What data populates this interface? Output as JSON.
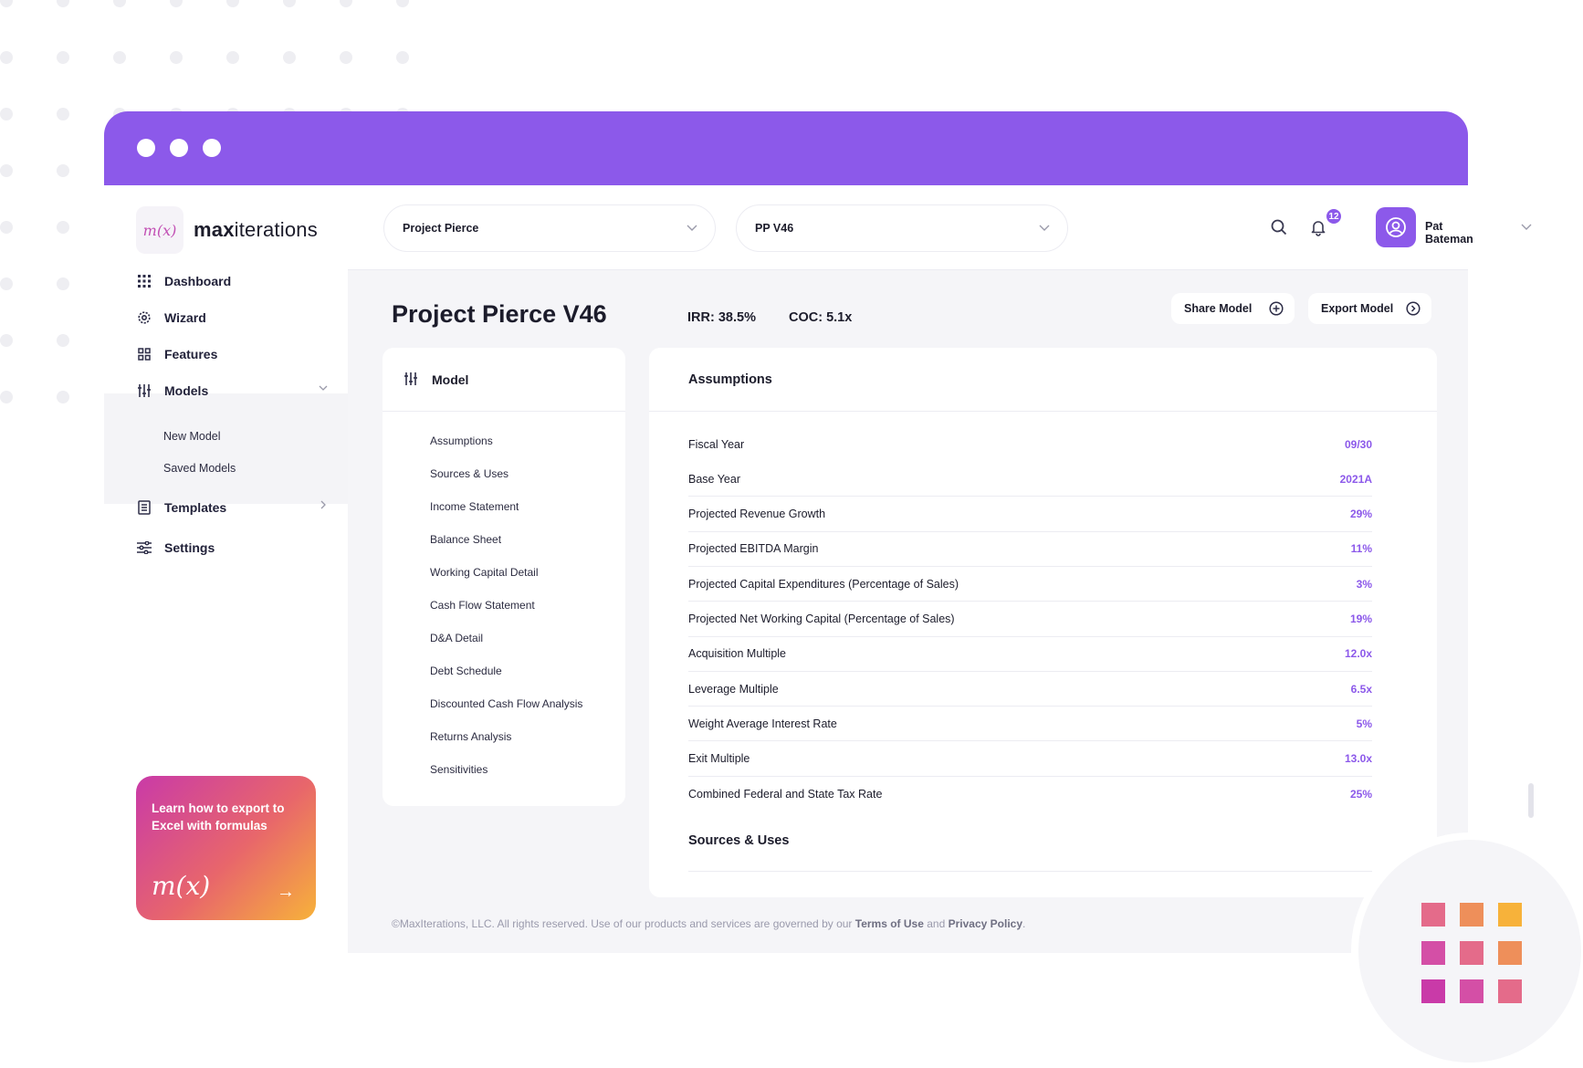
{
  "brand": {
    "logo_mark": "m(x)",
    "name_bold": "max",
    "name_rest": "iterations"
  },
  "sidebar": {
    "items": [
      {
        "label": "Dashboard",
        "icon": "grid-dots-icon"
      },
      {
        "label": "Wizard",
        "icon": "gear-icon"
      },
      {
        "label": "Features",
        "icon": "squares-icon"
      },
      {
        "label": "Models",
        "icon": "sliders-icon"
      },
      {
        "label": "Templates",
        "icon": "document-icon"
      },
      {
        "label": "Settings",
        "icon": "settings-sliders-icon"
      }
    ],
    "models_sub": [
      {
        "label": "New Model"
      },
      {
        "label": "Saved Models"
      }
    ],
    "promo": {
      "text": "Learn how to export to Excel with formulas",
      "logo": "m(x)",
      "arrow": "→"
    }
  },
  "topbar": {
    "project_select": "Project Pierce",
    "version_select": "PP V46",
    "notifications_count": "12",
    "user_name": "Pat Bateman"
  },
  "page": {
    "title": "Project Pierce V46",
    "irr_label": "IRR:",
    "irr_value": "38.5%",
    "coc_label": "COC:",
    "coc_value": "5.1x",
    "share_label": "Share Model",
    "export_label": "Export Model"
  },
  "model_panel": {
    "title": "Model",
    "links": [
      "Assumptions",
      "Sources & Uses",
      "Income Statement",
      "Balance Sheet",
      "Working Capital Detail",
      "Cash Flow Statement",
      "D&A Detail",
      "Debt Schedule",
      "Discounted Cash Flow Analysis",
      "Returns Analysis",
      "Sensitivities"
    ]
  },
  "assumptions": {
    "title": "Assumptions",
    "rows": [
      {
        "label": "Fiscal Year",
        "value": "09/30"
      },
      {
        "label": "Base Year",
        "value": "2021A"
      },
      {
        "label": "Projected Revenue Growth",
        "value": "29%"
      },
      {
        "label": "Projected EBITDA Margin",
        "value": "11%"
      },
      {
        "label": "Projected Capital Expenditures (Percentage of Sales)",
        "value": "3%"
      },
      {
        "label": "Projected Net Working Capital (Percentage of Sales)",
        "value": "19%"
      },
      {
        "label": "Acquisition Multiple",
        "value": "12.0x"
      },
      {
        "label": "Leverage Multiple",
        "value": "6.5x"
      },
      {
        "label": "Weight Average Interest Rate",
        "value": "5%"
      },
      {
        "label": "Exit Multiple",
        "value": "13.0x"
      },
      {
        "label": "Combined Federal and State Tax Rate",
        "value": "25%"
      }
    ],
    "next_section": "Sources & Uses"
  },
  "footer": {
    "text": "©MaxIterations, LLC. All rights reserved. Use of our products and services are governed by our",
    "terms": "Terms of Use",
    "and": "and",
    "privacy": "Privacy Policy",
    "period": "."
  },
  "colors": {
    "accent": "#8c59ea",
    "background": "#f5f5f8",
    "text": "#1c1c2b"
  }
}
